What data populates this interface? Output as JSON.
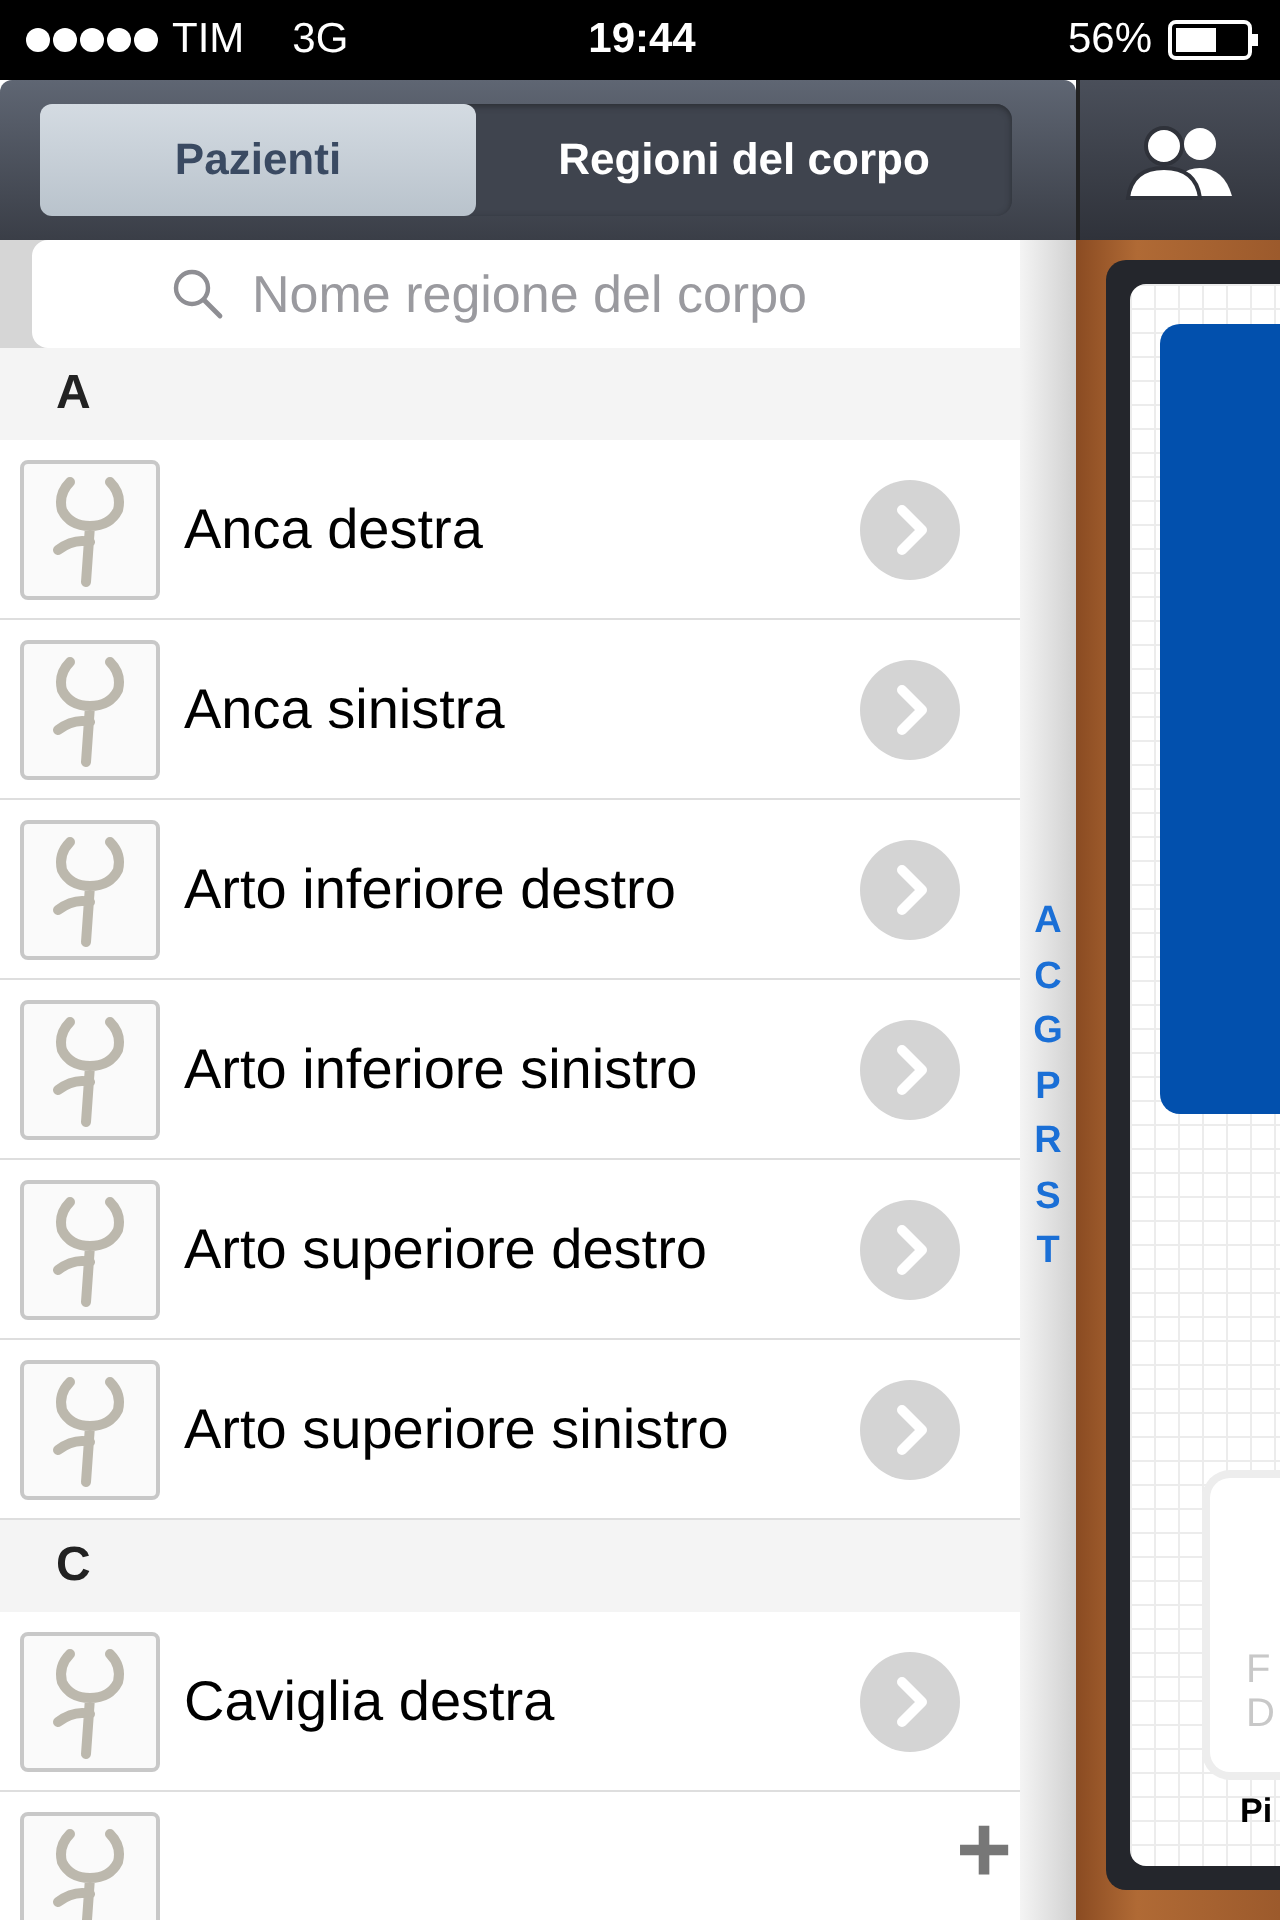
{
  "status_bar": {
    "carrier": "TIM",
    "network": "3G",
    "time": "19:44",
    "battery": "56%"
  },
  "tabs": [
    {
      "label": "Pazienti",
      "selected": true
    },
    {
      "label": "Regioni del corpo",
      "selected": false
    }
  ],
  "search": {
    "placeholder": "Nome regione del corpo"
  },
  "sections": [
    {
      "letter": "A",
      "items": [
        {
          "kind": "entry",
          "label": "Anca destra"
        },
        {
          "kind": "entry",
          "label": "Anca sinistra"
        },
        {
          "kind": "entry",
          "label": "Arto inferiore destro"
        },
        {
          "kind": "entry",
          "label": "Arto inferiore sinistro"
        },
        {
          "kind": "entry",
          "label": "Arto superiore destro"
        },
        {
          "kind": "entry",
          "label": "Arto superiore sinistro"
        }
      ]
    },
    {
      "letter": "C",
      "items": [
        {
          "kind": "entry",
          "label": "Caviglia destra"
        },
        {
          "kind": "cut"
        }
      ]
    }
  ],
  "index": [
    "A",
    "C",
    "G",
    "P",
    "R",
    "S",
    "T"
  ],
  "add_button": "+",
  "notebook": {
    "card_lines": [
      "F",
      "D"
    ],
    "caption": "Pi"
  }
}
